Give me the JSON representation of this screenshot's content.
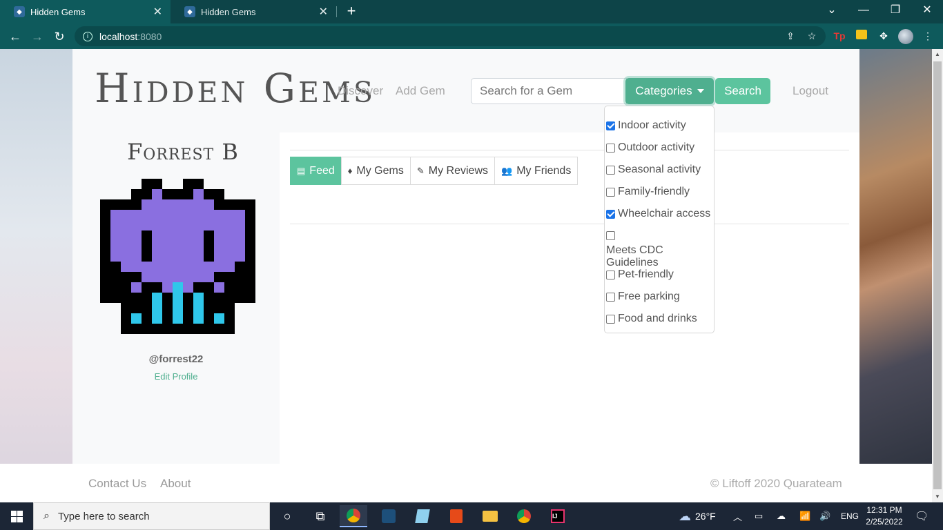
{
  "browser": {
    "tabs": [
      {
        "title": "Hidden Gems",
        "active": true
      },
      {
        "title": "Hidden Gems",
        "active": false
      }
    ],
    "address": {
      "host": "localhost",
      "port": ":8080"
    },
    "icons": {
      "back": "back-arrow-icon",
      "forward": "forward-arrow-icon",
      "reload": "reload-icon",
      "info": "info-icon",
      "share": "share-icon",
      "star": "bookmark-star-icon",
      "extensions": "puzzle-icon"
    }
  },
  "header": {
    "logo": "Hidden Gems",
    "nav": {
      "discover": "Discover",
      "add_gem": "Add Gem"
    },
    "search": {
      "placeholder": "Search for a Gem",
      "value": ""
    },
    "categories_label": "Categories",
    "search_button": "Search",
    "logout": "Logout"
  },
  "categories": [
    {
      "label": "Indoor activity",
      "checked": true
    },
    {
      "label": "Outdoor activity",
      "checked": false
    },
    {
      "label": "Seasonal activity",
      "checked": false
    },
    {
      "label": "Family-friendly",
      "checked": false
    },
    {
      "label": "Wheelchair access",
      "checked": true
    },
    {
      "label": "Meets CDC Guidelines",
      "checked": false
    },
    {
      "label": "Pet-friendly",
      "checked": false
    },
    {
      "label": "Free parking",
      "checked": false
    },
    {
      "label": "Food and drinks",
      "checked": false
    }
  ],
  "profile": {
    "name": "Forrest B",
    "handle": "@forrest22",
    "edit_label": "Edit Profile",
    "avatar_colors": {
      "outline": "#000000",
      "body": "#8a6fe0",
      "accent": "#2fc7ea"
    }
  },
  "main": {
    "tabs": [
      {
        "label": "Feed",
        "icon": "feed-icon",
        "active": true
      },
      {
        "label": "My Gems",
        "icon": "gem-icon",
        "active": false
      },
      {
        "label": "My Reviews",
        "icon": "feather-icon",
        "active": false
      },
      {
        "label": "My Friends",
        "icon": "people-icon",
        "active": false
      }
    ]
  },
  "footer": {
    "contact": "Contact Us",
    "about": "About",
    "copyright": "© Liftoff 2020 Quarateam"
  },
  "taskbar": {
    "search_placeholder": "Type here to search",
    "weather": "26°F",
    "language": "ENG",
    "time": "12:31 PM",
    "date": "2/25/2022"
  },
  "colors": {
    "accent": "#5cc49e",
    "accent_dark": "#4faf8f",
    "browser_frame": "#0e5a5c"
  }
}
